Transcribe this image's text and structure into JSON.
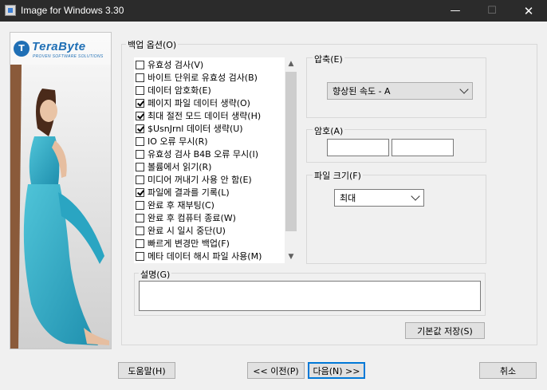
{
  "window": {
    "title": "Image for Windows 3.30",
    "minimize": "—",
    "maximize": "☐",
    "close": "✕"
  },
  "logo": {
    "mark": "T",
    "name": "TeraByte",
    "tagline": "PROVEN SOFTWARE SOLUTIONS"
  },
  "backup_options": {
    "label": "백업 옵션(O)",
    "items": [
      {
        "label": "유효성 검사(V)",
        "checked": false
      },
      {
        "label": "바이트 단위로 유효성 검사(B)",
        "checked": false
      },
      {
        "label": "데이터 암호화(E)",
        "checked": false
      },
      {
        "label": "페이지 파일 데이터 생략(O)",
        "checked": true
      },
      {
        "label": "최대 절전 모드 데이터 생략(H)",
        "checked": true
      },
      {
        "label": "$UsnJrnl 데이터 생략(U)",
        "checked": true
      },
      {
        "label": "IO 오류 무시(R)",
        "checked": false
      },
      {
        "label": "유효성 검사 B4B 오류 무시(I)",
        "checked": false
      },
      {
        "label": "볼륨에서 읽기(R)",
        "checked": false
      },
      {
        "label": "미디어 꺼내기 사용 안 함(E)",
        "checked": false
      },
      {
        "label": "파일에 결과를 기록(L)",
        "checked": true
      },
      {
        "label": "완료 후 재부팅(C)",
        "checked": false
      },
      {
        "label": "완료 후 컴퓨터 종료(W)",
        "checked": false
      },
      {
        "label": "완료 시 일시 중단(U)",
        "checked": false
      },
      {
        "label": "빠르게 변경만 백업(F)",
        "checked": false
      },
      {
        "label": "메타 데이터 해시 파일 사용(M)",
        "checked": false
      },
      {
        "label": "",
        "checked": false
      }
    ]
  },
  "compression": {
    "label": "압축(E)",
    "selected": "향상된 속도 - A"
  },
  "encryption": {
    "label": "암호(A)",
    "password": "",
    "confirm": ""
  },
  "file_size": {
    "label": "파일 크기(F)",
    "selected": "최대"
  },
  "description": {
    "label": "설명(G)",
    "value": ""
  },
  "buttons": {
    "save_default": "기본값 저장(S)",
    "help": "도움말(H)",
    "back": "<< 이전(P)",
    "next": "다음(N) >>",
    "cancel": "취소"
  },
  "scroll": {
    "up": "▲",
    "down": "▼"
  }
}
